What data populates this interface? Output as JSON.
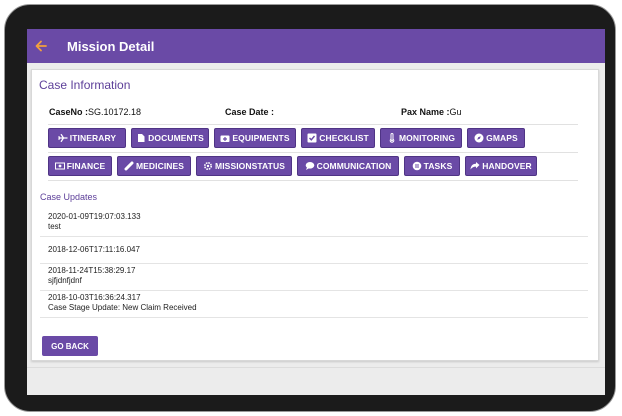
{
  "appbar": {
    "title": "Mission Detail"
  },
  "card": {
    "title": "Case Information",
    "case_no_label": "CaseNo :",
    "case_no_value": "SG.10172.18",
    "case_date_label": "Case Date :",
    "case_date_value": "",
    "pax_name_label": "Pax Name :",
    "pax_name_value": "Gu"
  },
  "buttons_row1": [
    {
      "label": "ITINERARY",
      "icon": "plane-icon"
    },
    {
      "label": "DOCUMENTS",
      "icon": "document-icon"
    },
    {
      "label": "EQUIPMENTS",
      "icon": "medkit-icon"
    },
    {
      "label": "CHECKLIST",
      "icon": "checkbox-icon"
    },
    {
      "label": "MONITORING",
      "icon": "thermometer-icon"
    },
    {
      "label": "GMAPS",
      "icon": "compass-icon"
    }
  ],
  "buttons_row2": [
    {
      "label": "FINANCE",
      "icon": "money-icon"
    },
    {
      "label": "MEDICINES",
      "icon": "pill-icon"
    },
    {
      "label": "MISSIONSTATUS",
      "icon": "gear-icon"
    },
    {
      "label": "COMMUNICATION",
      "icon": "chat-icon"
    },
    {
      "label": "TASKS",
      "icon": "tasks-icon"
    },
    {
      "label": "HANDOVER",
      "icon": "share-icon"
    }
  ],
  "updates": {
    "title": "Case Updates",
    "items": [
      {
        "timestamp": "2020-01-09T19:07:03.133",
        "text": "test"
      },
      {
        "timestamp": "2018-12-06T17:11:16.047",
        "text": ""
      },
      {
        "timestamp": "2018-11-24T15:38:29.17",
        "text": "sjfjdnfjdnf"
      },
      {
        "timestamp": "2018-10-03T16:36:24.317",
        "text": "Case Stage Update: New Claim Received"
      }
    ]
  },
  "go_back_label": "GO BACK",
  "colors": {
    "primary": "#6a4aa6",
    "back_arrow": "#f2a03d"
  }
}
